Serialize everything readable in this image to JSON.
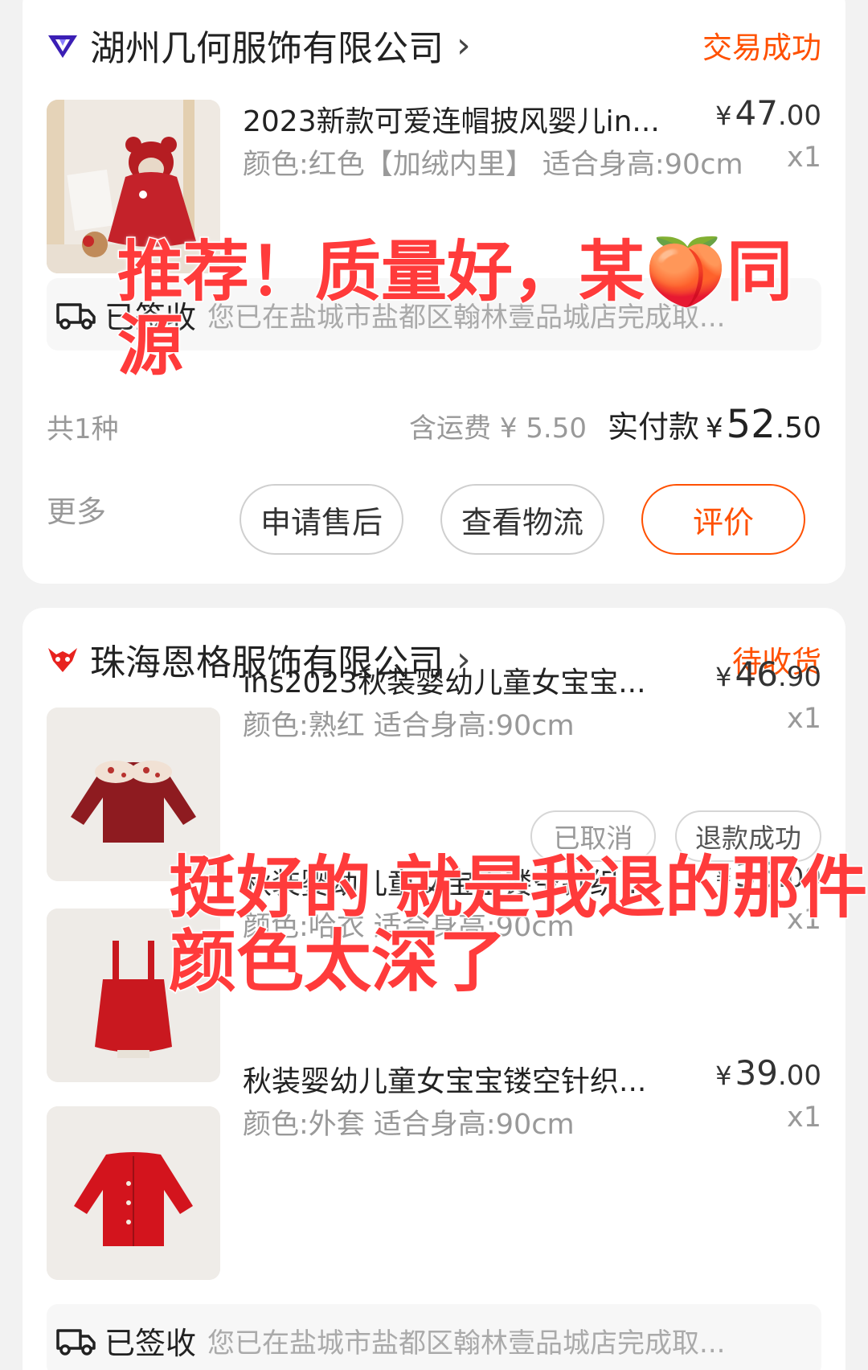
{
  "orders": [
    {
      "shop_name": "湖州几何服饰有限公司",
      "shop_chevron": "›",
      "status": "交易成功",
      "item": {
        "title": "2023新款可爱连帽披风婴儿in...",
        "price_int": "47",
        "price_dec": ".00",
        "spec": "颜色:红色【加绒内里】 适合身高:90cm",
        "qty": "x1"
      },
      "logistics": {
        "status": "已签收",
        "detail": "您已在盐城市盐都区翰林壹品城店完成取..."
      },
      "summary": {
        "count": "共1种",
        "shipping": "含运费 ¥ 5.50",
        "paid_label": "实付款",
        "paid_int": "52",
        "paid_dec": ".50"
      },
      "more": "更多",
      "buttons": {
        "after_sales": "申请售后",
        "logistics": "查看物流",
        "review": "评价"
      }
    },
    {
      "shop_name": "珠海恩格服饰有限公司",
      "shop_chevron": "›",
      "status": "待收货",
      "items": [
        {
          "title": "ins2023秋装婴幼儿童女宝宝...",
          "price_int": "46",
          "price_dec": ".90",
          "spec": "颜色:熟红 适合身高:90cm",
          "qty": "x1"
        },
        {
          "title": "秋装婴幼儿童女宝宝镂空针织...",
          "price_int": "36",
          "price_dec": ".00",
          "spec": "颜色:哈衣 适合身高:90cm",
          "qty": "x1"
        },
        {
          "title": "秋装婴幼儿童女宝宝镂空针织...",
          "price_int": "39",
          "price_dec": ".00",
          "spec": "颜色:外套 适合身高:90cm",
          "qty": "x1"
        }
      ],
      "tags": {
        "cancelled": "已取消",
        "refunded": "退款成功"
      },
      "logistics": {
        "status": "已签收",
        "detail": "您已在盐城市盐都区翰林壹品城店完成取..."
      }
    }
  ],
  "currency": "¥",
  "overlays": {
    "first_line1": "推荐！质量好，某🍑同",
    "first_line2": "源",
    "second_line1": "挺好的 就是我退的那件",
    "second_line2": "颜色太深了"
  },
  "colors": {
    "accent": "#ff5000",
    "overlay": "#ff3b3b"
  }
}
